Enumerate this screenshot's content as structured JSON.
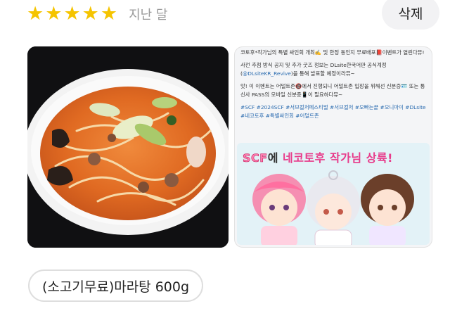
{
  "review": {
    "rating_stars": 5,
    "rating_max": 5,
    "period": "지난 달",
    "delete_label": "삭제",
    "tag": "(소고기무료)마라탕 600g"
  },
  "photo_food": {
    "alt": "마라탕 사진"
  },
  "photo_promo": {
    "line1": "코토후*작가님의 특별 싸인회 개최✍️ 및 한정 동인지 무료배포📕이벤트가 열린다뮤!",
    "line2": "사전 추첨 방식 공지 및 추가 굿즈 정보는 DLsite한국어판 공식계정 (",
    "line2_handle": "@DLsiteKR_Revive",
    "line2_end": ")을 통해 발표할 예정이라뮤~",
    "line3": "앗! 이 이벤트는 어덜트존🔞에서 진행되니 어덜트존 입장을 위해선 신분증🪪 또는 통신사 PASS의 모바일 신분증📱이 필요하다뮤~",
    "tags": "#SCF #2024SCF #서브컬처페스티벌 #서브컬처 #오빠는끝 #오니마이 #DLsite #네코토후 #특별싸인회 #어덜트존",
    "banner_scf": "SCF",
    "banner_e": "에 ",
    "banner_neko": "네코토후",
    "banner_rest": " 작가님 상륙!"
  },
  "colors": {
    "star": "#f5c400",
    "link": "#2b6cb0",
    "accent_pink": "#e83a8a"
  }
}
